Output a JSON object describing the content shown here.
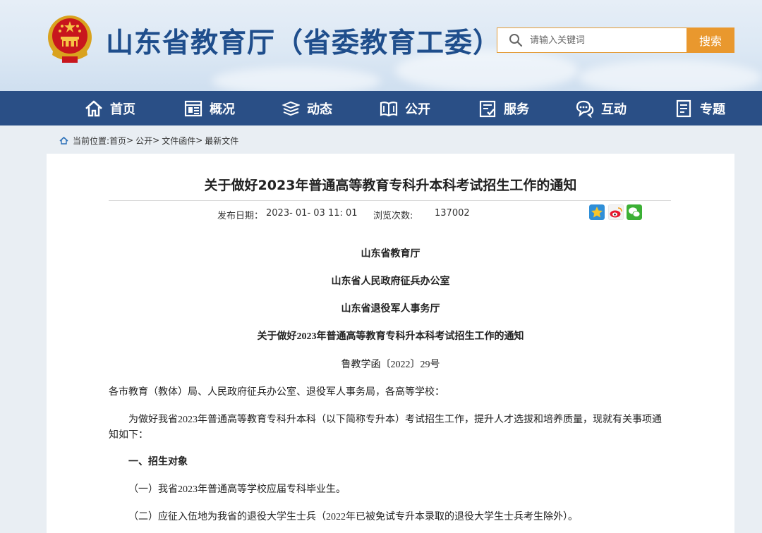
{
  "header": {
    "title": "山东省教育厅（省委教育工委）",
    "search_placeholder": "请输入关键词",
    "search_button": "搜索"
  },
  "nav": {
    "items": [
      {
        "label": "首页",
        "icon": "home-icon"
      },
      {
        "label": "概况",
        "icon": "overview-icon"
      },
      {
        "label": "动态",
        "icon": "news-icon"
      },
      {
        "label": "公开",
        "icon": "book-icon"
      },
      {
        "label": "服务",
        "icon": "service-icon"
      },
      {
        "label": "互动",
        "icon": "chat-icon"
      },
      {
        "label": "专题",
        "icon": "topic-icon"
      }
    ]
  },
  "breadcrumb": {
    "prefix": "当前位置:",
    "items": [
      "首页",
      "公开",
      "文件函件",
      "最新文件"
    ],
    "separator": ">"
  },
  "article": {
    "title": "关于做好2023年普通高等教育专科升本科考试招生工作的通知",
    "publish_label": "发布日期：",
    "publish_date": "2023- 01- 03 11: 01",
    "views_label": "浏览次数:",
    "views": "137002",
    "issuers": [
      "山东省教育厅",
      "山东省人民政府征兵办公室",
      "山东省退役军人事务厅"
    ],
    "inner_title": "关于做好2023年普通高等教育专科升本科考试招生工作的通知",
    "doc_number": "鲁教学函〔2022〕29号",
    "addressee": "各市教育（教体）局、人民政府征兵办公室、退役军人事务局，各高等学校：",
    "intro_line1": "为做好我省2023年普通高等教育专科升本科（以下简称专升本）考试招生工作，提升人才选拔和培养质量，现就有关事项通",
    "intro_line2": "知如下：",
    "section1": "一、招生对象",
    "item1": "（一）我省2023年普通高等学校应届专科毕业生。",
    "item2": "（二）应征入伍地为我省的退役大学生士兵（2022年已被免试专升本录取的退役大学生士兵考生除外）。"
  },
  "colors": {
    "nav_bg": "#2a4f86",
    "title_blue": "#1f4e8c",
    "search_orange": "#e9982e"
  }
}
